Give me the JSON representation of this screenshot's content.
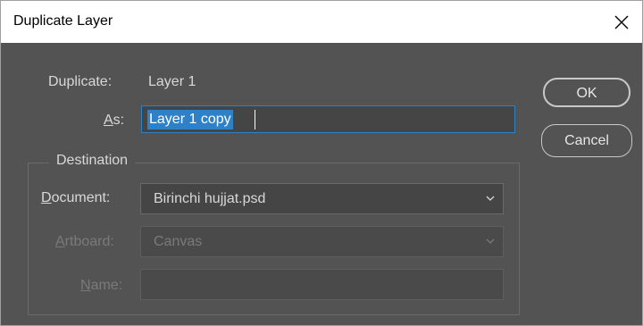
{
  "window": {
    "title": "Duplicate Layer"
  },
  "duplicate": {
    "label": "Duplicate:",
    "value": "Layer 1"
  },
  "as": {
    "label_key": "A",
    "label_rest": "s:",
    "value": "Layer 1 copy"
  },
  "buttons": {
    "ok": "OK",
    "cancel": "Cancel"
  },
  "destination": {
    "legend": "Destination",
    "document": {
      "label_key": "D",
      "label_rest": "ocument:",
      "value": "Birinchi hujjat.psd"
    },
    "artboard": {
      "label_key": "A",
      "label_rest": "rtboard:",
      "value": "Canvas"
    },
    "name": {
      "label_key": "N",
      "label_rest": "ame:",
      "value": ""
    }
  },
  "colors": {
    "background": "#535353",
    "accent": "#2f81c7",
    "titlebar": "#ffffff"
  },
  "icons": {
    "close": "close-icon",
    "chevron": "chevron-down-icon"
  }
}
